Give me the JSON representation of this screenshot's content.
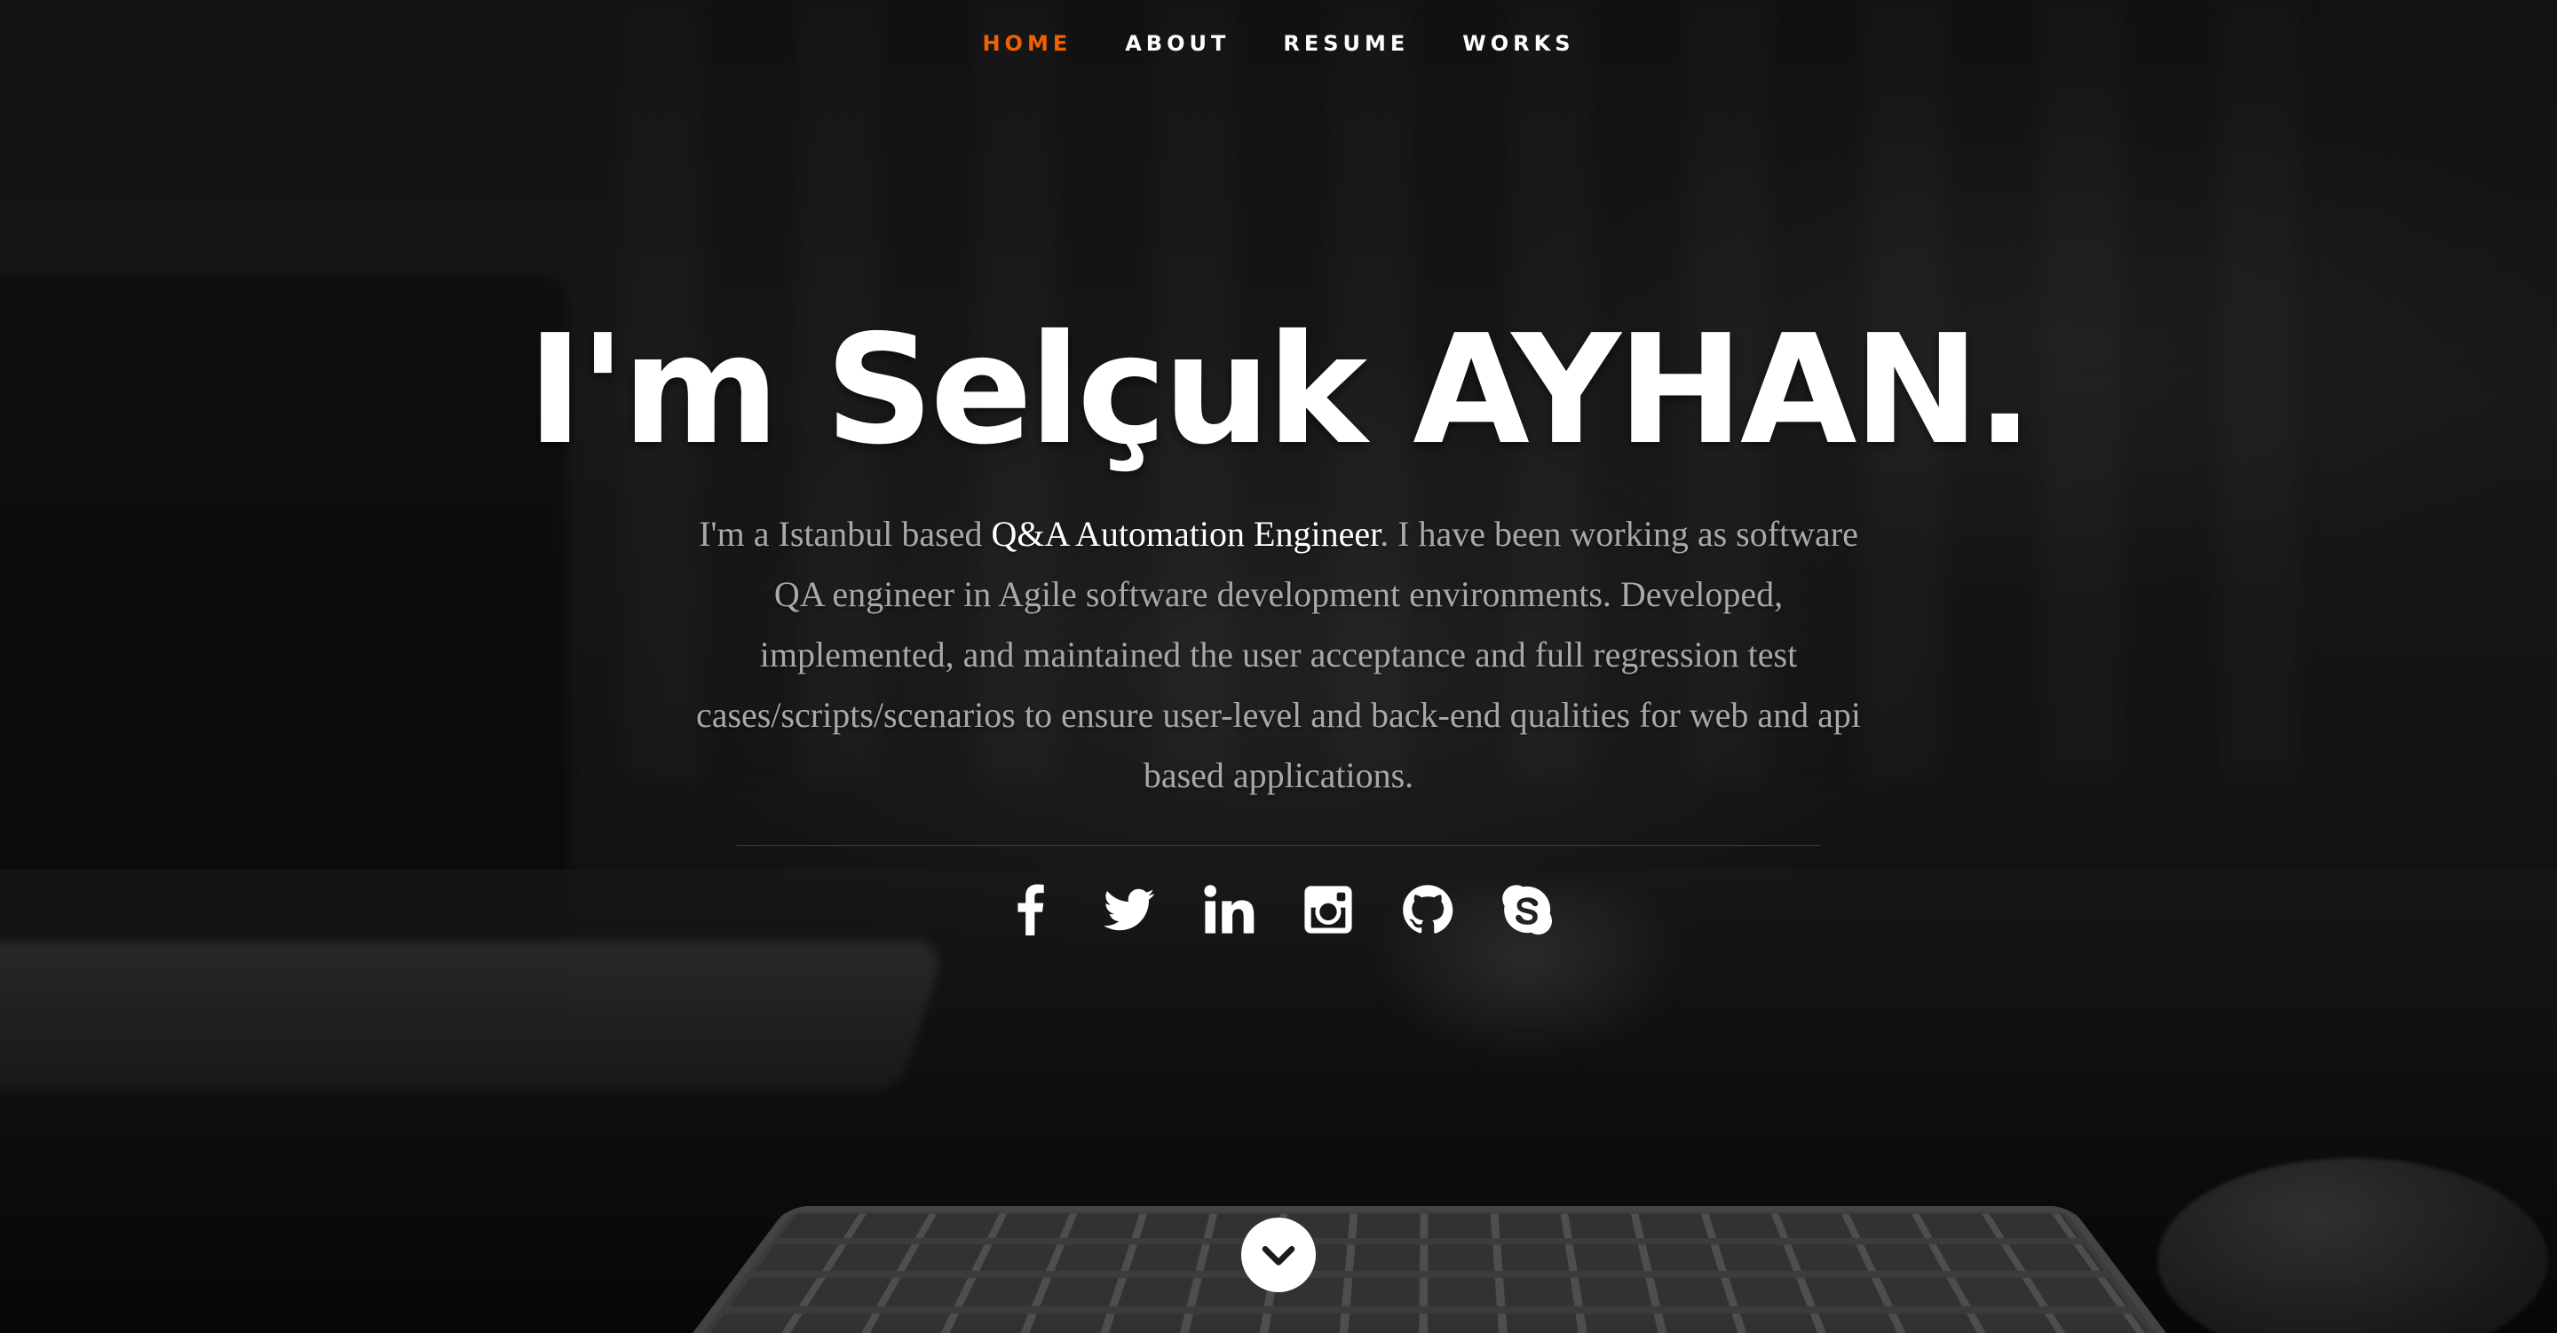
{
  "nav": {
    "items": [
      {
        "label": "HOME",
        "active": true
      },
      {
        "label": "ABOUT",
        "active": false
      },
      {
        "label": "RESUME",
        "active": false
      },
      {
        "label": "WORKS",
        "active": false
      }
    ],
    "active_color": "#f06000"
  },
  "banner": {
    "headline": "I'm Selçuk AYHAN.",
    "intro_before": "I'm a Istanbul based ",
    "intro_highlight": "Q&A Automation Engineer",
    "intro_after": ". I have been working as software QA engineer in Agile software development environments. Developed, implemented, and maintained the user acceptance and full regression test cases/scripts/scenarios to ensure user-level and back-end qualities for web and api based applications."
  },
  "social": {
    "icons": [
      "facebook-icon",
      "twitter-icon",
      "linkedin-icon",
      "instagram-icon",
      "github-icon",
      "skype-icon"
    ]
  },
  "scroll": {
    "icon": "chevron-down-icon"
  }
}
